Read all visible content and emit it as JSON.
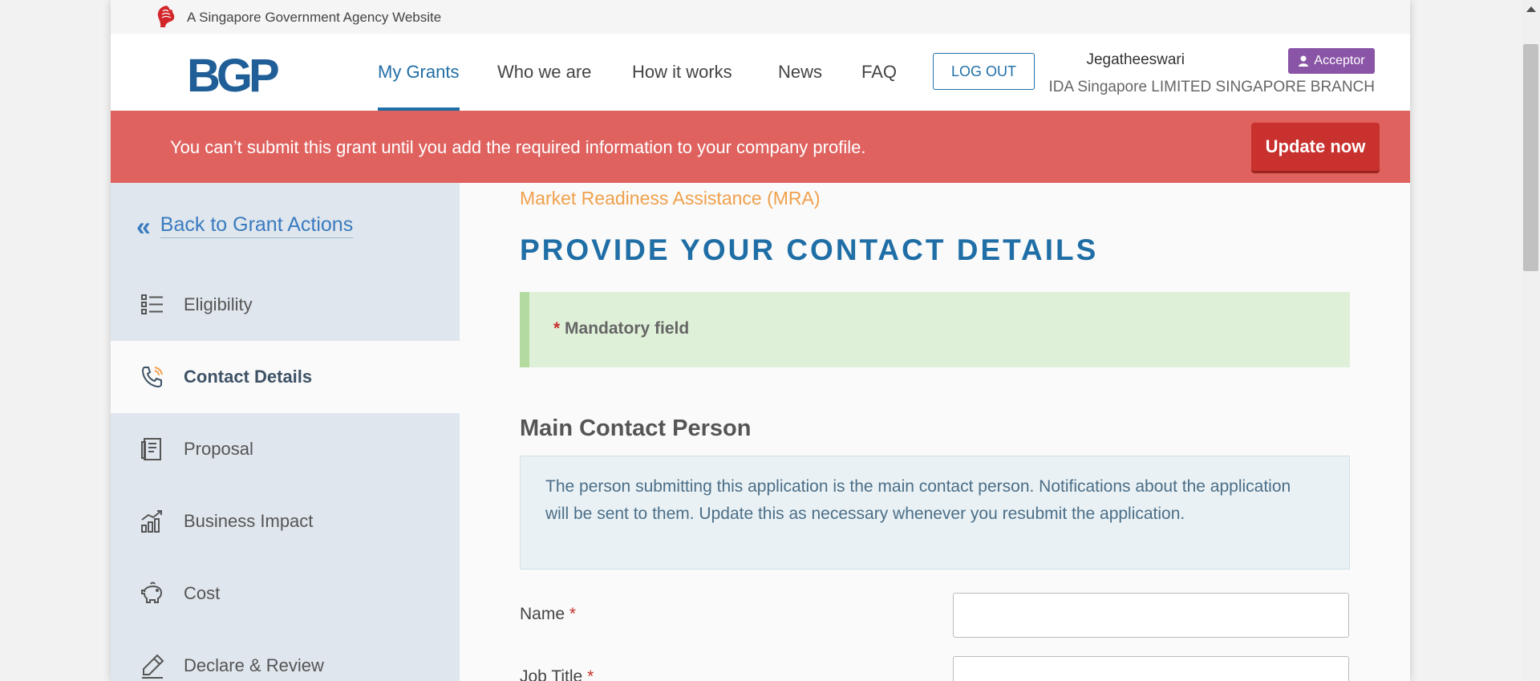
{
  "gov_banner": {
    "text": "A Singapore Government Agency Website",
    "icon": "lion-head-icon"
  },
  "header": {
    "logo": "BGP",
    "nav": [
      {
        "label": "My Grants",
        "active": true
      },
      {
        "label": "Who we are"
      },
      {
        "label": "How it works"
      },
      {
        "label": "News"
      },
      {
        "label": "FAQ"
      }
    ],
    "logout_label": "LOG OUT",
    "user_name": "Jegatheeswari",
    "role_badge": "Acceptor",
    "company": "IDA Singapore LIMITED SINGAPORE BRANCH"
  },
  "alert": {
    "text": "You can’t submit this grant until you add the required information to your company profile.",
    "button_label": "Update now",
    "color": "#df625f"
  },
  "sidebar": {
    "back_label": "Back to Grant Actions",
    "items": [
      {
        "label": "Eligibility",
        "icon": "list-icon"
      },
      {
        "label": "Contact Details",
        "icon": "phone-icon",
        "active": true
      },
      {
        "label": "Proposal",
        "icon": "document-icon"
      },
      {
        "label": "Business Impact",
        "icon": "bar-chart-icon"
      },
      {
        "label": "Cost",
        "icon": "piggy-bank-icon"
      },
      {
        "label": "Declare & Review",
        "icon": "pen-icon"
      }
    ]
  },
  "main": {
    "grant_name": "Market Readiness Assistance (MRA)",
    "page_title": "PROVIDE YOUR CONTACT DETAILS",
    "mandatory_note": "Mandatory field",
    "section_title": "Main Contact Person",
    "info_text": "The person submitting this application is the main contact person. Notifications about the application will be sent to them. Update this as necessary whenever you resubmit the application.",
    "fields": [
      {
        "label": "Name",
        "value": ""
      },
      {
        "label": "Job Title",
        "value": ""
      }
    ],
    "required_marker": "*"
  },
  "colors": {
    "accent": "#1f6ea6",
    "role_badge": "#8a55a6",
    "grant_name": "#f0a04b",
    "mandatory_bg": "#dff0d8"
  }
}
